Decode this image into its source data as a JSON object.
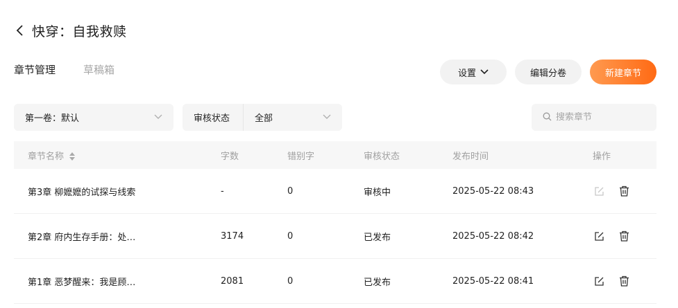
{
  "header": {
    "title": "快穿：自我救赎"
  },
  "tabs": [
    {
      "label": "章节管理",
      "active": true
    },
    {
      "label": "草稿箱",
      "active": false
    }
  ],
  "actions": {
    "settings_label": "设置",
    "volume_label": "编辑分卷",
    "new_label": "新建章节"
  },
  "filters": {
    "volume_value": "第一卷：默认",
    "status_label": "审核状态",
    "status_value": "全部",
    "search_placeholder": "搜索章节"
  },
  "table": {
    "columns": [
      "章节名称",
      "字数",
      "错别字",
      "审核状态",
      "发布时间",
      "操作"
    ],
    "rows": [
      {
        "name": "第3章 柳嬷嬷的试探与线索",
        "words": "-",
        "typos": "0",
        "status": "审核中",
        "time": "2025-05-22 08:43"
      },
      {
        "name": "第2章 府内生存手册：处…",
        "words": "3174",
        "typos": "0",
        "status": "已发布",
        "time": "2025-05-22 08:42"
      },
      {
        "name": "第1章 恶梦醒来：我是顾…",
        "words": "2081",
        "typos": "0",
        "status": "已发布",
        "time": "2025-05-22 08:41"
      }
    ]
  },
  "colors": {
    "accent_start": "#ff9a50",
    "accent_end": "#ff6a14"
  },
  "icons": [
    "chevron-left-icon",
    "chevron-down-icon",
    "search-icon",
    "sort-icon",
    "edit-icon",
    "trash-icon"
  ]
}
